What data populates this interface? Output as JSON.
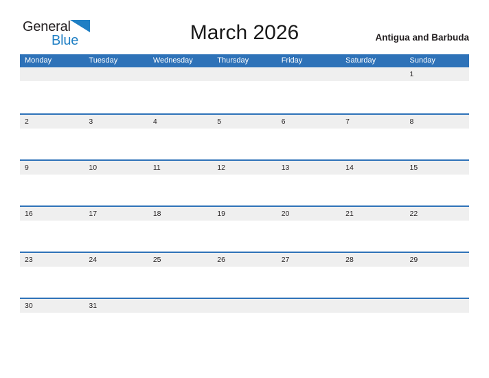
{
  "brand": {
    "word_one": "General",
    "word_two": "Blue",
    "logo_color": "#1f7fc4",
    "text_color": "#231f20",
    "flag_icon": "blue-triangle-flag"
  },
  "header": {
    "month_title": "March 2026",
    "country": "Antigua and Barbuda"
  },
  "theme": {
    "header_blue": "#2e72b8",
    "row_band_gray": "#efefef",
    "page_background": "#ffffff",
    "text_dark": "#231f20",
    "weekday_text": "#ffffff"
  },
  "calendar": {
    "weekday_headers": [
      "Monday",
      "Tuesday",
      "Wednesday",
      "Thursday",
      "Friday",
      "Saturday",
      "Sunday"
    ],
    "weeks": [
      [
        "",
        "",
        "",
        "",
        "",
        "",
        "1"
      ],
      [
        "2",
        "3",
        "4",
        "5",
        "6",
        "7",
        "8"
      ],
      [
        "9",
        "10",
        "11",
        "12",
        "13",
        "14",
        "15"
      ],
      [
        "16",
        "17",
        "18",
        "19",
        "20",
        "21",
        "22"
      ],
      [
        "23",
        "24",
        "25",
        "26",
        "27",
        "28",
        "29"
      ],
      [
        "30",
        "31",
        "",
        "",
        "",
        "",
        ""
      ]
    ]
  }
}
